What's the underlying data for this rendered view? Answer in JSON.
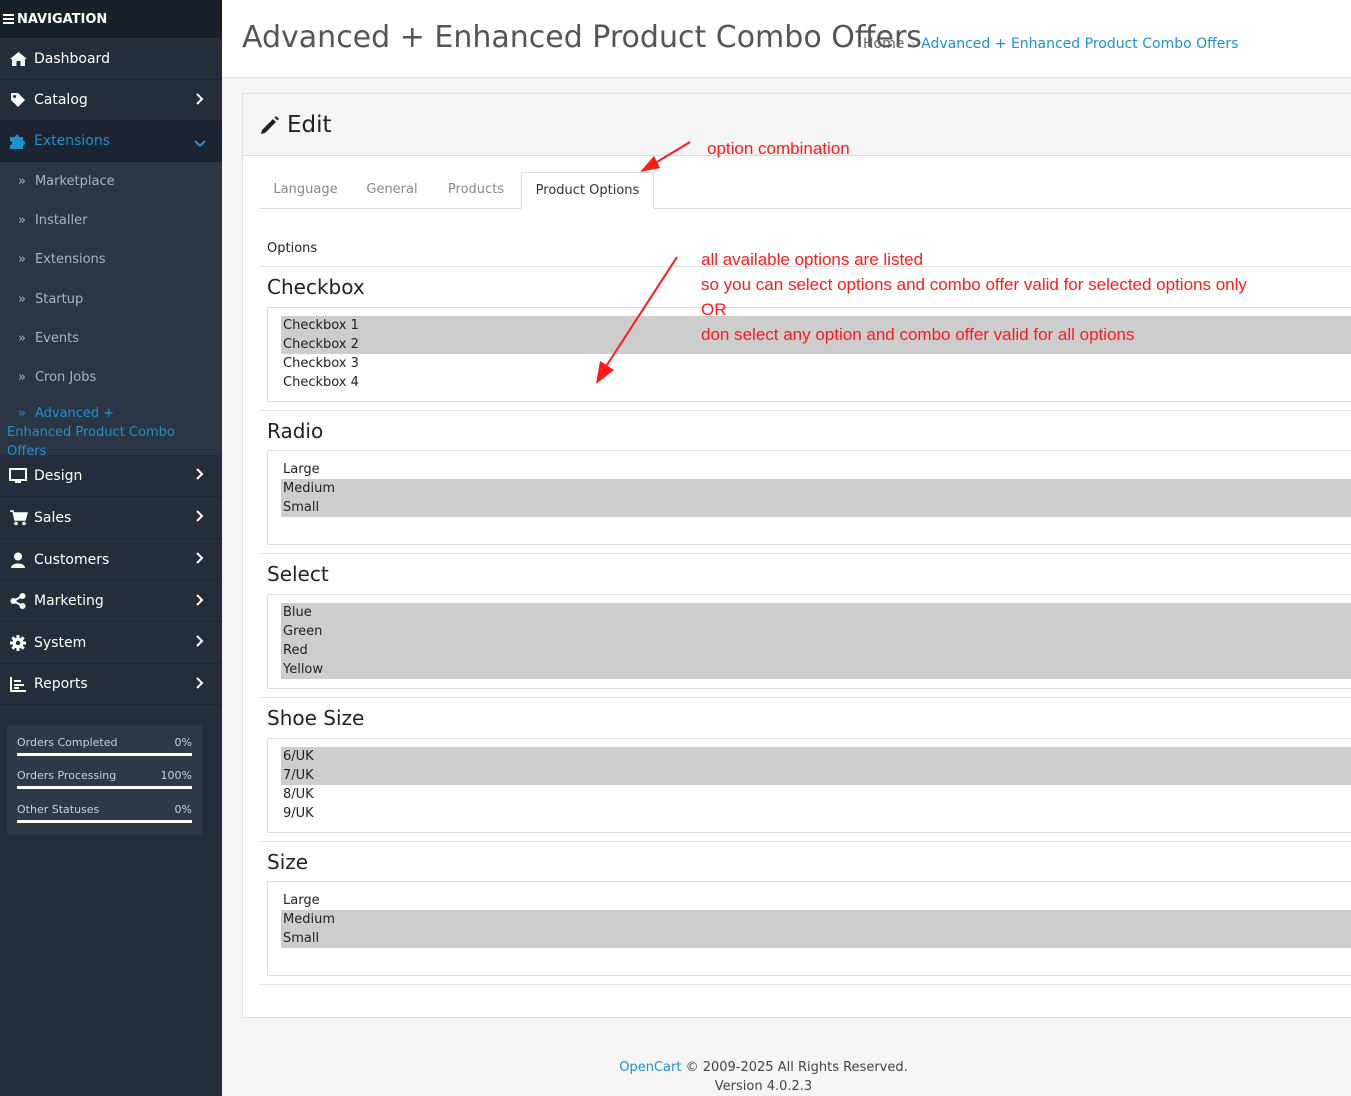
{
  "nav": {
    "header": "NAVIGATION",
    "items": [
      {
        "label": "Dashboard",
        "icon": "home-icon"
      },
      {
        "label": "Catalog",
        "icon": "tag-icon"
      },
      {
        "label": "Extensions",
        "icon": "puzzle-icon"
      },
      {
        "label": "Design",
        "icon": "desktop-icon"
      },
      {
        "label": "Sales",
        "icon": "cart-icon"
      },
      {
        "label": "Customers",
        "icon": "user-icon"
      },
      {
        "label": "Marketing",
        "icon": "share-icon"
      },
      {
        "label": "System",
        "icon": "gear-icon"
      },
      {
        "label": "Reports",
        "icon": "chart-icon"
      }
    ],
    "extensions_sub": [
      {
        "label": "Marketplace"
      },
      {
        "label": "Installer"
      },
      {
        "label": "Extensions"
      },
      {
        "label": "Startup"
      },
      {
        "label": "Events"
      },
      {
        "label": "Cron Jobs"
      },
      {
        "label": "Advanced + Enhanced Product Combo Offers"
      }
    ],
    "stats": [
      {
        "label": "Orders Completed",
        "value": "0%"
      },
      {
        "label": "Orders Processing",
        "value": "100%"
      },
      {
        "label": "Other Statuses",
        "value": "0%"
      }
    ]
  },
  "header": {
    "title": "Advanced + Enhanced Product Combo Offers",
    "breadcrumb": [
      {
        "label": "Home"
      },
      {
        "label": "Advanced + Enhanced Product Combo Offers"
      }
    ]
  },
  "card": {
    "title": "Edit",
    "tabs": [
      "Language",
      "General",
      "Products",
      "Product Options"
    ],
    "options_label": "Options",
    "groups": [
      {
        "title": "Checkbox",
        "options": [
          {
            "label": "Checkbox 1",
            "selected": true
          },
          {
            "label": "Checkbox 2",
            "selected": true
          },
          {
            "label": "Checkbox 3",
            "selected": false
          },
          {
            "label": "Checkbox 4",
            "selected": false
          }
        ]
      },
      {
        "title": "Radio",
        "options": [
          {
            "label": "Large",
            "selected": false
          },
          {
            "label": "Medium",
            "selected": true
          },
          {
            "label": "Small",
            "selected": true
          }
        ]
      },
      {
        "title": "Select",
        "options": [
          {
            "label": "Blue",
            "selected": true
          },
          {
            "label": "Green",
            "selected": true
          },
          {
            "label": "Red",
            "selected": true
          },
          {
            "label": "Yellow",
            "selected": true
          }
        ]
      },
      {
        "title": "Shoe Size",
        "options": [
          {
            "label": "6/UK",
            "selected": true
          },
          {
            "label": "7/UK",
            "selected": true
          },
          {
            "label": "8/UK",
            "selected": false
          },
          {
            "label": "9/UK",
            "selected": false
          }
        ]
      },
      {
        "title": "Size",
        "options": [
          {
            "label": "Large",
            "selected": false
          },
          {
            "label": "Medium",
            "selected": true
          },
          {
            "label": "Small",
            "selected": true
          }
        ]
      }
    ]
  },
  "footer": {
    "link": "OpenCart",
    "copyright": "© 2009-2025 All Rights Reserved.",
    "version": "Version 4.0.2.3"
  },
  "annotations": {
    "tab_note": "option combination",
    "lines": [
      "all available options are listed",
      "so you can select options and combo offer valid for selected options only",
      "OR",
      "don select any option and combo offer valid for all options"
    ]
  },
  "colors": {
    "accent": "#1e91cf",
    "sidebar": "#242e3a",
    "annotation": "#ff1a1a",
    "selected": "#cdcdcd"
  }
}
